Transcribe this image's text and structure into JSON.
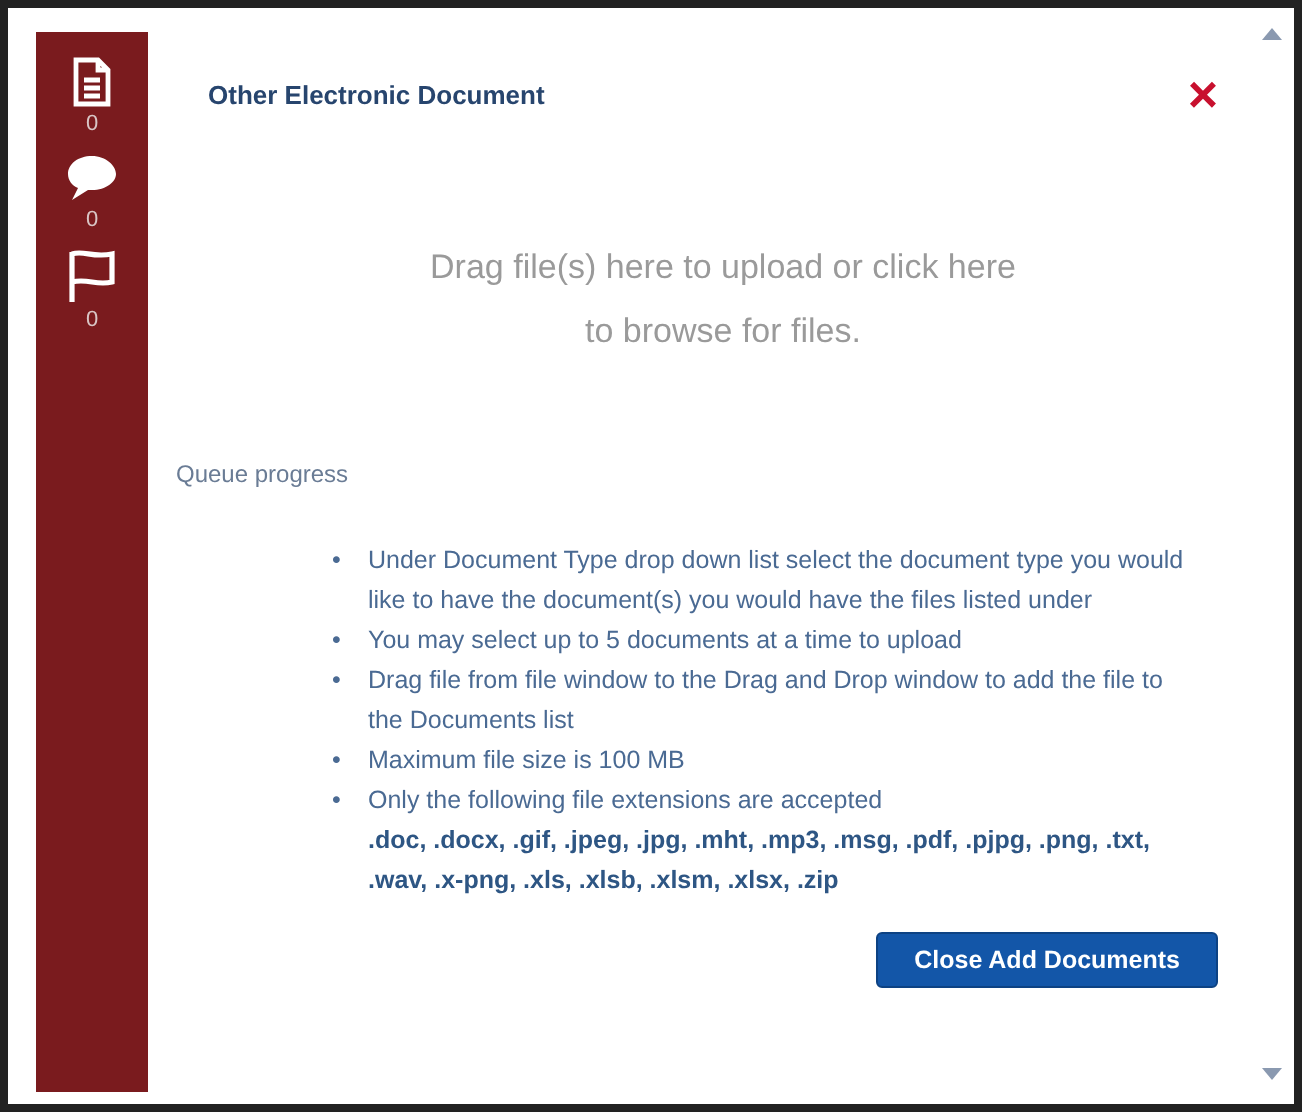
{
  "sidebar": {
    "items": [
      {
        "kind": "document",
        "count": "0"
      },
      {
        "kind": "comment",
        "count": "0"
      },
      {
        "kind": "flag",
        "count": "0"
      }
    ]
  },
  "dialog": {
    "title": "Other Electronic Document",
    "close": "×"
  },
  "drop_zone": {
    "text": "Drag file(s) here to upload or click here to browse for files."
  },
  "queue_label": "Queue progress",
  "instructions": [
    {
      "bullet": "•",
      "text": "Under Document Type drop down list select the document type you would like to have the document(s) you would have the files listed under"
    },
    {
      "bullet": "•",
      "text": "You may select up to 5 documents at a time to upload"
    },
    {
      "bullet": "•",
      "text": "Drag file from file window to the Drag and Drop window to add the file to the Documents list"
    },
    {
      "bullet": "•",
      "text": "Maximum file size is 100 MB"
    },
    {
      "bullet": "•",
      "text": "Only the following file extensions are accepted"
    }
  ],
  "extensions": ".doc, .docx, .gif, .jpeg, .jpg, .mht, .mp3, .msg, .pdf, .pjpg, .png, .txt, .wav, .x-png, .xls, .xlsb, .xlsm, .xlsx, .zip",
  "button": "Close Add Documents"
}
